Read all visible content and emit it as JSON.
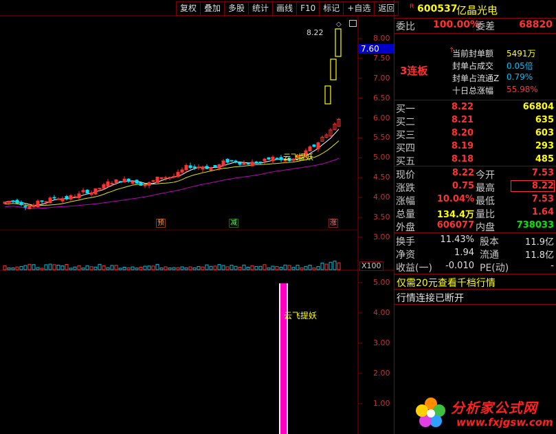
{
  "toolbar": {
    "items": [
      "复权",
      "叠加",
      "多股",
      "统计",
      "画线",
      "F10",
      "标记",
      "+自选",
      "返回"
    ]
  },
  "chart": {
    "price_axis": [
      "8.00",
      "7.50",
      "7.00",
      "6.50",
      "6.00",
      "5.50",
      "5.00",
      "4.50",
      "4.00",
      "3.50",
      "3.00"
    ],
    "current_price_tag": "7.60",
    "high_marker": "8.22",
    "signal_label": "云飞提妖",
    "markers": [
      "预",
      "减",
      "涨"
    ],
    "volume_scale": "X100",
    "indicator_axis": [
      "5.00",
      "4.00",
      "3.00",
      "2.00",
      "1.00"
    ],
    "indicator_label": "云飞提妖",
    "colors": {
      "up": "#ff3232",
      "down": "#00e0ff",
      "ma_white": "#ffffff",
      "ma_yellow": "#e6e600",
      "ma_purple": "#c000c0"
    }
  },
  "quote": {
    "r_mark": "R",
    "code": "600537",
    "name": "亿晶光电",
    "weibi_label": "委比",
    "weibi_value": "100.00%",
    "weicha_label": "委差",
    "weicha_value": "68820",
    "board_label": "3连板",
    "info": [
      {
        "label": "当前封单额",
        "value": "5491万"
      },
      {
        "label": "封单占成交",
        "value": "0.05倍"
      },
      {
        "label": "封单占流通Z",
        "value": "0.79%"
      },
      {
        "label": "十日总涨幅",
        "value": "55.98%"
      }
    ],
    "bids": [
      {
        "label": "买一",
        "price": "8.22",
        "vol": "66804"
      },
      {
        "label": "买二",
        "price": "8.21",
        "vol": "635"
      },
      {
        "label": "买三",
        "price": "8.20",
        "vol": "603"
      },
      {
        "label": "买四",
        "price": "8.19",
        "vol": "293"
      },
      {
        "label": "买五",
        "price": "8.18",
        "vol": "485"
      }
    ],
    "stats": [
      {
        "l1": "现价",
        "v1": "8.22",
        "l2": "今开",
        "v2": "7.53"
      },
      {
        "l1": "涨跌",
        "v1": "0.75",
        "l2": "最高",
        "v2": "8.22"
      },
      {
        "l1": "涨幅",
        "v1": "10.04%",
        "l2": "最低",
        "v2": "7.53"
      },
      {
        "l1": "总量",
        "v1": "134.4万",
        "l2": "量比",
        "v2": "1.64"
      },
      {
        "l1": "外盘",
        "v1": "606077",
        "l2": "内盘",
        "v2": "738033"
      }
    ],
    "fund": [
      {
        "l1": "换手",
        "v1": "11.43%",
        "l2": "股本",
        "v2": "11.9亿"
      },
      {
        "l1": "净资",
        "v1": "1.94",
        "l2": "流通",
        "v2": "11.8亿"
      },
      {
        "l1": "收益(一)",
        "v1": "-0.010",
        "l2": "PE(动)",
        "v2": "-"
      }
    ],
    "promo": "仅需20元查看千档行情",
    "status": "行情连接已断开",
    "watermark_cn": "分析家公式网",
    "watermark_url": "www.fxjgsw.com"
  }
}
